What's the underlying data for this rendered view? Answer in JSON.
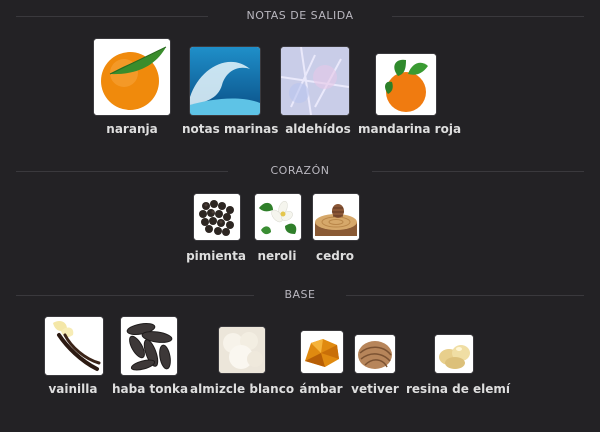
{
  "sections": {
    "top": {
      "title": "NOTAS DE SALIDA"
    },
    "middle": {
      "title": "CORAZÓN"
    },
    "base": {
      "title": "BASE"
    }
  },
  "top_notes": [
    {
      "name": "naranja",
      "icon": "orange-image"
    },
    {
      "name": "notas marinas",
      "icon": "ocean-wave-image"
    },
    {
      "name": "aldehídos",
      "icon": "frost-crystal-image"
    },
    {
      "name": "mandarina roja",
      "icon": "mandarin-image"
    }
  ],
  "heart_notes": [
    {
      "name": "pimienta",
      "icon": "peppercorn-image"
    },
    {
      "name": "neroli",
      "icon": "neroli-flower-image"
    },
    {
      "name": "cedro",
      "icon": "cedar-wood-image"
    }
  ],
  "base_notes": [
    {
      "name": "vainilla",
      "icon": "vanilla-image"
    },
    {
      "name": "haba tonka",
      "icon": "tonka-bean-image"
    },
    {
      "name": "almizcle blanco",
      "icon": "white-musk-image"
    },
    {
      "name": "ámbar",
      "icon": "amber-image"
    },
    {
      "name": "vetiver",
      "icon": "vetiver-image"
    },
    {
      "name": "resina de elemí",
      "icon": "elemi-resin-image"
    }
  ],
  "colors": {
    "background": "#232225",
    "divider": "#3a393d",
    "header_text": "#b9b7bf",
    "label_text": "#dedede"
  }
}
